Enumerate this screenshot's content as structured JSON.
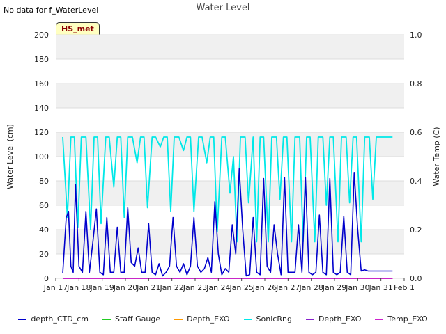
{
  "header": {
    "no_data": "No data for f_WaterLevel",
    "title": "Water Level",
    "badge": "HS_met"
  },
  "chart_data": {
    "type": "line",
    "title": "Water Level",
    "ylabel": "Water Level (cm)",
    "y2label": "Water Temp (C)",
    "ylim": [
      0,
      200
    ],
    "y2lim": [
      0.0,
      1.0
    ],
    "yticks": [
      "0",
      "20",
      "40",
      "60",
      "80",
      "100",
      "120",
      "140",
      "160",
      "180",
      "200"
    ],
    "y2ticks": [
      "0.0",
      "0.2",
      "0.4",
      "0.6",
      "0.8",
      "1.0"
    ],
    "xticks": [
      "Jan 17",
      "Jan 18",
      "Jan 19",
      "Jan 20",
      "Jan 21",
      "Jan 22",
      "Jan 23",
      "Jan 24",
      "Jan 25",
      "Jan 26",
      "Jan 27",
      "Jan 28",
      "Jan 29",
      "Jan 30",
      "Jan 31",
      "Feb 1"
    ],
    "xlim_days": [
      17,
      32
    ],
    "grid": true,
    "legend_position": "bottom",
    "series": [
      {
        "name": "depth_CTD_cm",
        "color": "#0000cc",
        "x": [
          17.3,
          17.45,
          17.55,
          17.65,
          17.75,
          17.85,
          18.0,
          18.15,
          18.3,
          18.45,
          18.6,
          18.75,
          18.9,
          19.05,
          19.2,
          19.35,
          19.5,
          19.65,
          19.8,
          19.95,
          20.1,
          20.25,
          20.4,
          20.55,
          20.7,
          20.85,
          21.0,
          21.15,
          21.3,
          21.45,
          21.6,
          21.75,
          21.9,
          22.05,
          22.2,
          22.35,
          22.5,
          22.65,
          22.8,
          22.95,
          23.1,
          23.25,
          23.4,
          23.55,
          23.7,
          23.85,
          24.0,
          24.15,
          24.3,
          24.45,
          24.6,
          24.75,
          24.9,
          25.05,
          25.2,
          25.35,
          25.5,
          25.65,
          25.8,
          25.95,
          26.1,
          26.25,
          26.4,
          26.55,
          26.7,
          26.85,
          27.0,
          27.15,
          27.3,
          27.45,
          27.6,
          27.75,
          27.9,
          28.05,
          28.2,
          28.35,
          28.5,
          28.65,
          28.8,
          28.95,
          29.1,
          29.25,
          29.4,
          29.55,
          29.7,
          29.85,
          30.0,
          30.15,
          30.3,
          30.45,
          30.6,
          30.75,
          30.9,
          31.05,
          31.2,
          31.35,
          31.5
        ],
        "values": [
          4,
          50,
          55,
          10,
          5,
          77,
          10,
          5,
          55,
          5,
          30,
          57,
          5,
          3,
          50,
          5,
          5,
          42,
          5,
          5,
          58,
          13,
          10,
          25,
          5,
          5,
          45,
          5,
          3,
          12,
          2,
          5,
          10,
          50,
          10,
          5,
          12,
          3,
          10,
          50,
          10,
          5,
          8,
          17,
          5,
          63,
          20,
          3,
          8,
          5,
          44,
          20,
          90,
          40,
          2,
          3,
          50,
          5,
          3,
          82,
          10,
          5,
          44,
          20,
          3,
          83,
          5,
          5,
          5,
          44,
          5,
          83,
          5,
          3,
          5,
          52,
          5,
          3,
          82,
          5,
          3,
          5,
          51,
          5,
          3,
          87,
          40,
          6,
          7,
          6,
          6,
          6,
          6,
          6,
          6,
          6,
          6
        ]
      },
      {
        "name": "Staff Gauge",
        "color": "#22cc22",
        "x": [],
        "values": []
      },
      {
        "name": "Depth_EXO",
        "color": "#ff9900",
        "x": [
          17.3,
          31.5
        ],
        "values": [
          0,
          0
        ]
      },
      {
        "name": "SonicRng",
        "color": "#00e8e8",
        "x": [
          17.3,
          17.5,
          17.65,
          17.8,
          17.95,
          18.1,
          18.3,
          18.5,
          18.65,
          18.8,
          18.95,
          19.15,
          19.3,
          19.5,
          19.65,
          19.8,
          19.95,
          20.1,
          20.3,
          20.5,
          20.65,
          20.8,
          20.95,
          21.15,
          21.3,
          21.5,
          21.65,
          21.8,
          21.95,
          22.1,
          22.3,
          22.5,
          22.65,
          22.8,
          22.95,
          23.15,
          23.3,
          23.5,
          23.65,
          23.8,
          23.95,
          24.15,
          24.3,
          24.5,
          24.65,
          24.8,
          24.95,
          25.15,
          25.3,
          25.5,
          25.65,
          25.8,
          25.95,
          26.15,
          26.3,
          26.5,
          26.65,
          26.8,
          26.95,
          27.15,
          27.3,
          27.5,
          27.65,
          27.8,
          27.95,
          28.15,
          28.3,
          28.5,
          28.65,
          28.8,
          28.95,
          29.15,
          29.3,
          29.5,
          29.65,
          29.8,
          29.95,
          30.15,
          30.3,
          30.5,
          30.65,
          30.8,
          30.95,
          31.15,
          31.3,
          31.5
        ],
        "values": [
          116,
          50,
          116,
          116,
          42,
          116,
          116,
          40,
          116,
          116,
          45,
          116,
          116,
          75,
          116,
          116,
          50,
          116,
          116,
          95,
          116,
          116,
          58,
          116,
          116,
          108,
          116,
          116,
          55,
          116,
          116,
          105,
          116,
          116,
          55,
          116,
          116,
          95,
          116,
          116,
          38,
          116,
          116,
          70,
          100,
          30,
          116,
          116,
          62,
          116,
          30,
          116,
          116,
          30,
          116,
          116,
          65,
          116,
          116,
          30,
          116,
          116,
          30,
          116,
          116,
          30,
          116,
          116,
          60,
          116,
          116,
          30,
          116,
          116,
          62,
          116,
          116,
          30,
          116,
          116,
          65,
          116,
          116,
          116,
          116,
          116
        ]
      },
      {
        "name": "Depth_EXO",
        "color": "#8822cc",
        "x": [
          17.3,
          31.5
        ],
        "values": [
          0,
          0
        ]
      },
      {
        "name": "Temp_EXO",
        "color": "#cc22cc",
        "x": [
          17.3,
          31.5
        ],
        "values": [
          0,
          0
        ]
      }
    ]
  }
}
